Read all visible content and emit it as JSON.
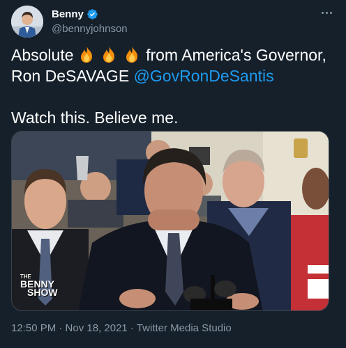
{
  "author": {
    "display_name": "Benny",
    "handle": "@bennyjohnson",
    "verified": true
  },
  "tweet": {
    "line1_before": "Absolute",
    "line1_emoji": "fire",
    "line1_emoji_count": 3,
    "line1_after": "from America's Governor,",
    "line2_prefix": "Ron DeSAVAGE",
    "mention": "@GovRonDeSantis",
    "line3": "Watch this. Believe me."
  },
  "media": {
    "watermark_line1": "THE",
    "watermark_line2": "BENNY",
    "watermark_line3": "SHOW"
  },
  "meta": {
    "timestamp": "12:50 PM · Nov 18, 2021 · Twitter Media Studio"
  },
  "colors": {
    "background": "#15202b",
    "text": "#ffffff",
    "secondary": "#8b98a5",
    "link": "#1d9bf0",
    "verified": "#1d9bf0"
  },
  "icons": [
    "verified-badge-icon",
    "more-options-icon",
    "fire-emoji-icon"
  ]
}
